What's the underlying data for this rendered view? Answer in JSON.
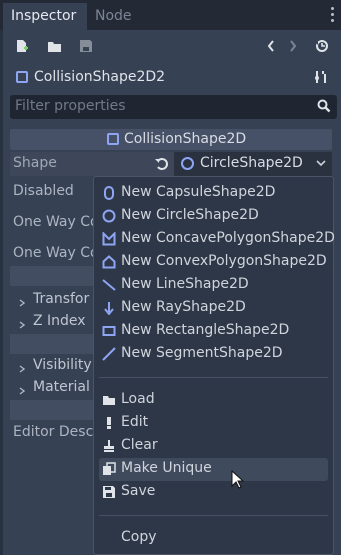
{
  "tabs": [
    {
      "label": "Inspector",
      "active": true
    },
    {
      "label": "Node",
      "active": false
    }
  ],
  "toolbar": {
    "icons": [
      "new-resource-icon",
      "open-folder-icon",
      "save-icon",
      "back-arrow-icon",
      "forward-arrow-icon",
      "history-icon"
    ]
  },
  "object": {
    "name": "CollisionShape2D2",
    "icon": "collision-shape-icon",
    "tools_icon": "object-tools-icon"
  },
  "filter": {
    "placeholder": "Filter properties"
  },
  "section": {
    "title": "CollisionShape2D"
  },
  "properties": [
    {
      "label": "Shape"
    },
    {
      "label": "Disabled"
    },
    {
      "label": "One Way Co"
    },
    {
      "label": "One Way Co"
    }
  ],
  "shape_value": "CircleShape2D",
  "groups": [
    {
      "label": "Transfor"
    },
    {
      "label": "Z Index"
    },
    {
      "label": "Visibility"
    },
    {
      "label": "Material"
    }
  ],
  "editor_desc": "Editor Descr",
  "menu": {
    "new_items": [
      {
        "label": "New CapsuleShape2D",
        "icon": "capsule-shape-icon"
      },
      {
        "label": "New CircleShape2D",
        "icon": "circle-shape-icon"
      },
      {
        "label": "New ConcavePolygonShape2D",
        "icon": "concave-polygon-shape-icon"
      },
      {
        "label": "New ConvexPolygonShape2D",
        "icon": "convex-polygon-shape-icon"
      },
      {
        "label": "New LineShape2D",
        "icon": "line-shape-icon"
      },
      {
        "label": "New RayShape2D",
        "icon": "ray-shape-icon"
      },
      {
        "label": "New RectangleShape2D",
        "icon": "rectangle-shape-icon"
      },
      {
        "label": "New SegmentShape2D",
        "icon": "segment-shape-icon"
      }
    ],
    "actions": [
      {
        "label": "Load",
        "icon": "load-icon"
      },
      {
        "label": "Edit",
        "icon": "edit-icon"
      },
      {
        "label": "Clear",
        "icon": "clear-icon"
      },
      {
        "label": "Make Unique",
        "icon": "make-unique-icon"
      },
      {
        "label": "Save",
        "icon": "save-icon"
      }
    ],
    "copy_label": "Copy"
  },
  "colors": {
    "accent_blue": "#8da5f3",
    "background": "#364154",
    "popup_bg": "#2e3747"
  }
}
